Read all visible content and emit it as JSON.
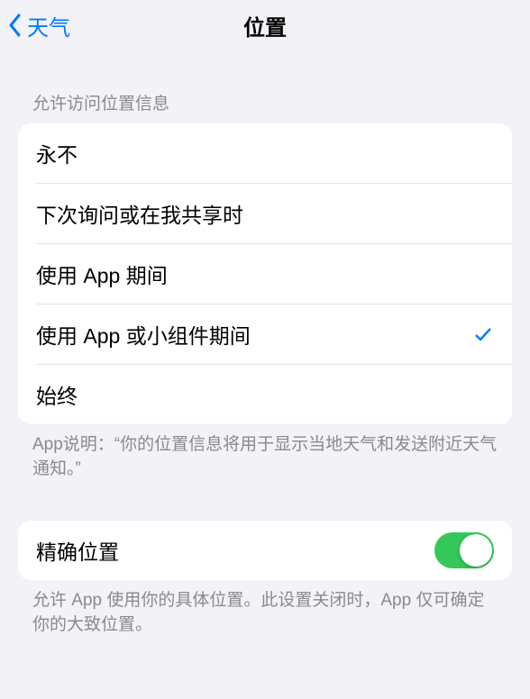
{
  "nav": {
    "back_label": "天气",
    "title": "位置"
  },
  "section1": {
    "header": "允许访问位置信息",
    "options": [
      {
        "label": "永不",
        "selected": false
      },
      {
        "label": "下次询问或在我共享时",
        "selected": false
      },
      {
        "label": "使用 App 期间",
        "selected": false
      },
      {
        "label": "使用 App 或小组件期间",
        "selected": true
      },
      {
        "label": "始终",
        "selected": false
      }
    ],
    "footer": "App说明：“你的位置信息将用于显示当地天气和发送附近天气通知。”"
  },
  "section2": {
    "precise_label": "精确位置",
    "precise_on": true,
    "footer": "允许 App 使用你的具体位置。此设置关闭时，App 仅可确定你的大致位置。"
  }
}
